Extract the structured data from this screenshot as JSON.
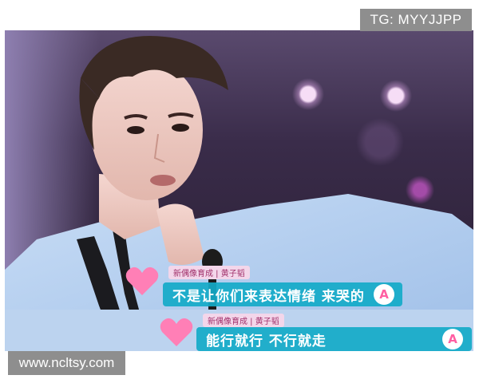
{
  "watermarks": {
    "top": "TG: MYYJJPP",
    "bottom": "www.ncltsy.com"
  },
  "subtitles": [
    {
      "tag": "新偶像育成 | 黄子韬",
      "text": "不是让你们来表达情绪 来哭的",
      "badge": "A"
    },
    {
      "tag": "新偶像育成 | 黄子韬",
      "text": "能行就行 不行就走",
      "badge": "A"
    }
  ],
  "colors": {
    "subtitle_bar": "#14aac8",
    "accent_pink": "#ff5fa2",
    "watermark_bg": "#8e8e8e"
  },
  "icons": [
    "heart-logo-icon",
    "letter-a-badge-icon",
    "microphone-icon"
  ]
}
